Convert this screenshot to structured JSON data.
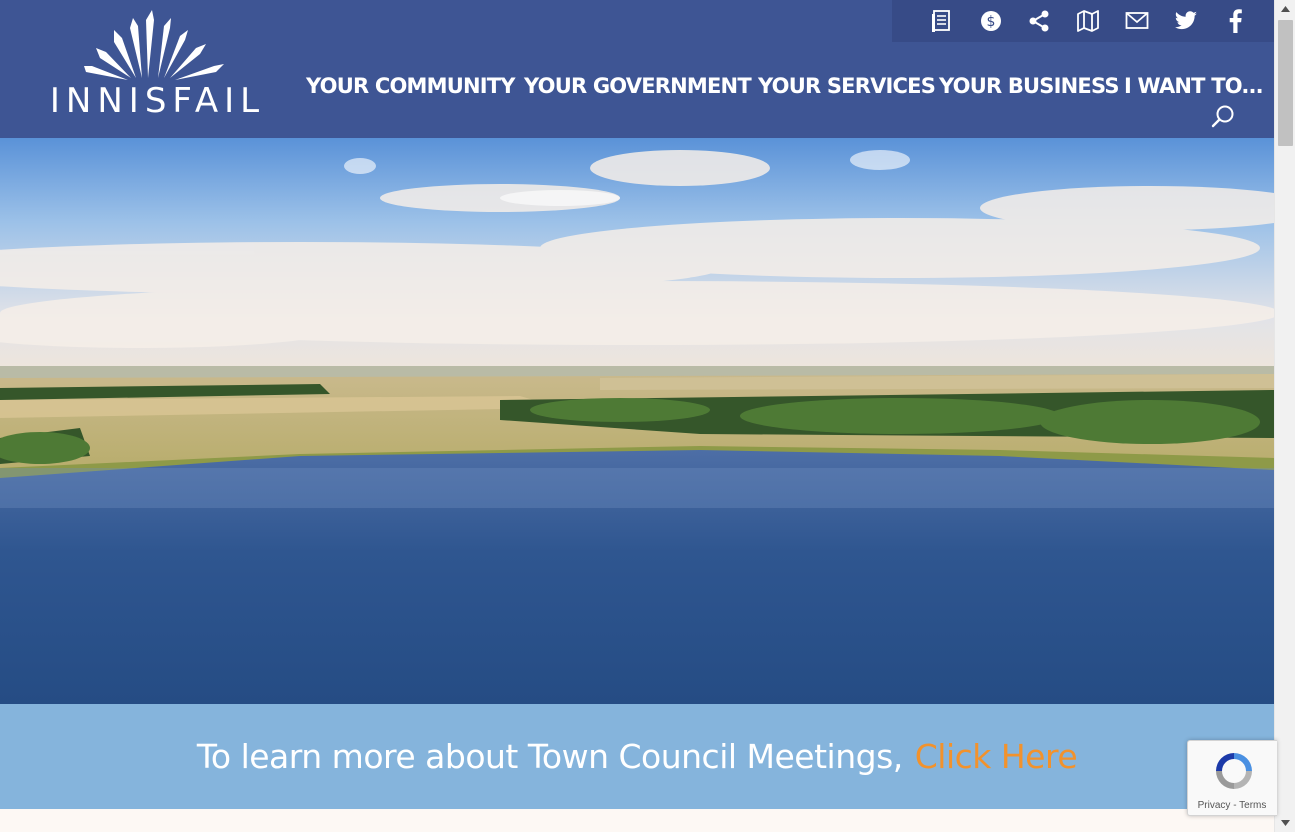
{
  "site": {
    "logo_text": "INNISFAIL"
  },
  "topbar": {
    "icons": [
      "newsletter-icon",
      "payment-icon",
      "share-icon",
      "map-icon",
      "email-icon",
      "twitter-icon",
      "facebook-icon"
    ]
  },
  "nav": {
    "items": [
      {
        "label": "YOUR COMMUNITY"
      },
      {
        "label": "YOUR GOVERNMENT"
      },
      {
        "label": "YOUR SERVICES"
      },
      {
        "label": "YOUR BUSINESS"
      },
      {
        "label": "I WANT TO..."
      }
    ]
  },
  "banner": {
    "text": "To learn more about Town Council Meetings,",
    "link": "Click Here"
  },
  "recaptcha": {
    "privacy": "Privacy",
    "separator": " - ",
    "terms": "Terms"
  },
  "colors": {
    "header": "#3e5594",
    "topbar": "#374b87",
    "banner": "#85b4dc",
    "link": "#f2922c"
  }
}
